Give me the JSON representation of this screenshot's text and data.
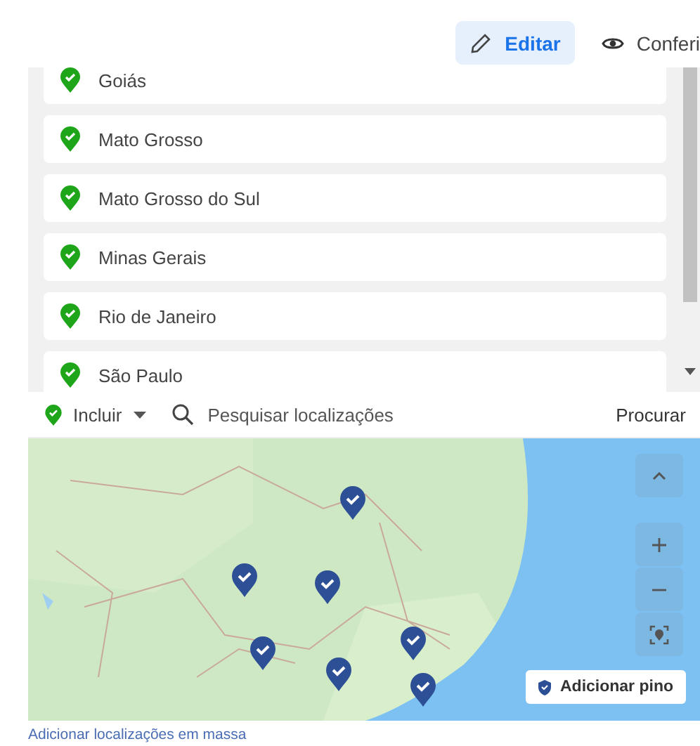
{
  "toolbar": {
    "buttons": [
      {
        "label": "Editar",
        "kind": "edit",
        "selected": true
      },
      {
        "label": "Conferi",
        "kind": "view",
        "selected": false
      }
    ]
  },
  "locations": [
    {
      "name": "Goiás",
      "included": true
    },
    {
      "name": "Mato Grosso",
      "included": true
    },
    {
      "name": "Mato Grosso do Sul",
      "included": true
    },
    {
      "name": "Minas Gerais",
      "included": true
    },
    {
      "name": "Rio de Janeiro",
      "included": true
    },
    {
      "name": "São Paulo",
      "included": true
    }
  ],
  "search": {
    "mode": "Incluir",
    "mode_included": true,
    "placeholder": "Pesquisar localizações",
    "action": "Procurar"
  },
  "map": {
    "kind": "picture",
    "add_pin_button": "Adicionar pino"
  },
  "bulk_link": "Adicionar localizações em massa"
}
